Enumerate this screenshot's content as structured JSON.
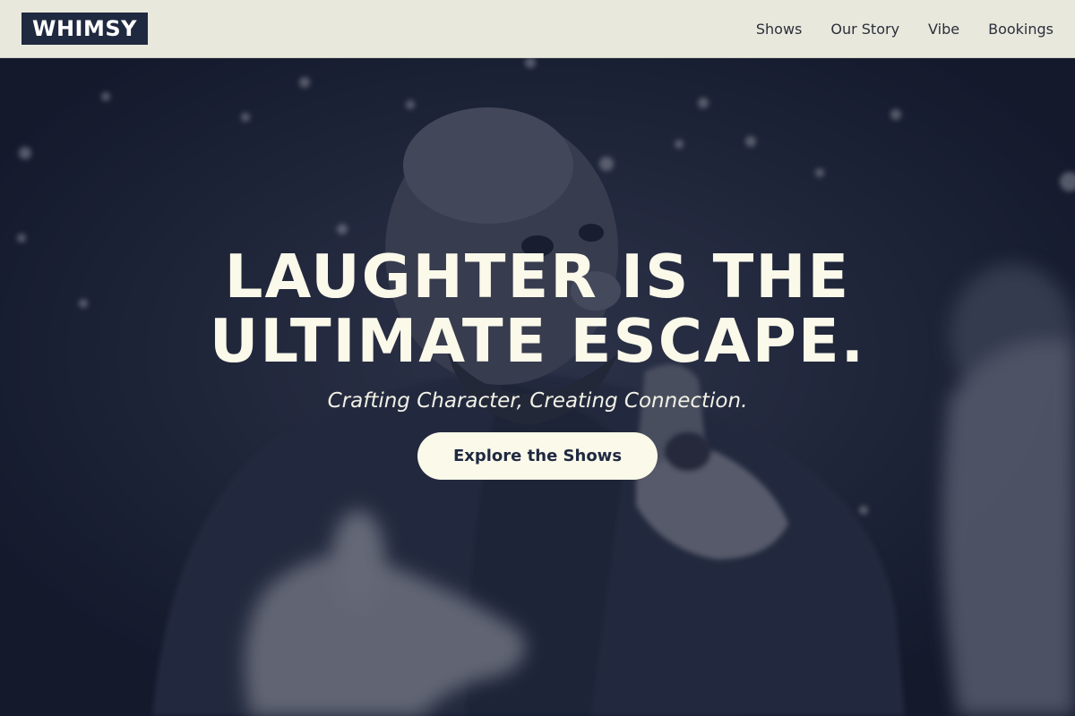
{
  "brand": {
    "logo_text": "WHIMSY"
  },
  "nav": {
    "items": [
      {
        "label": "Shows"
      },
      {
        "label": "Our Story"
      },
      {
        "label": "Vibe"
      },
      {
        "label": "Bookings"
      }
    ]
  },
  "hero": {
    "headline_line1": "LAUGHTER IS THE",
    "headline_line2": "ULTIMATE ESCAPE.",
    "tagline": "Crafting Character, Creating Connection.",
    "cta_label": "Explore the Shows",
    "image_description": "performer-pointing-at-camera"
  },
  "colors": {
    "nav_background": "#e8e8dd",
    "logo_background": "#1f2940",
    "hero_tint": "#161b2c",
    "headline_text": "#fbf9ea",
    "cta_background": "#fbf9ea",
    "cta_text": "#1f2940"
  }
}
